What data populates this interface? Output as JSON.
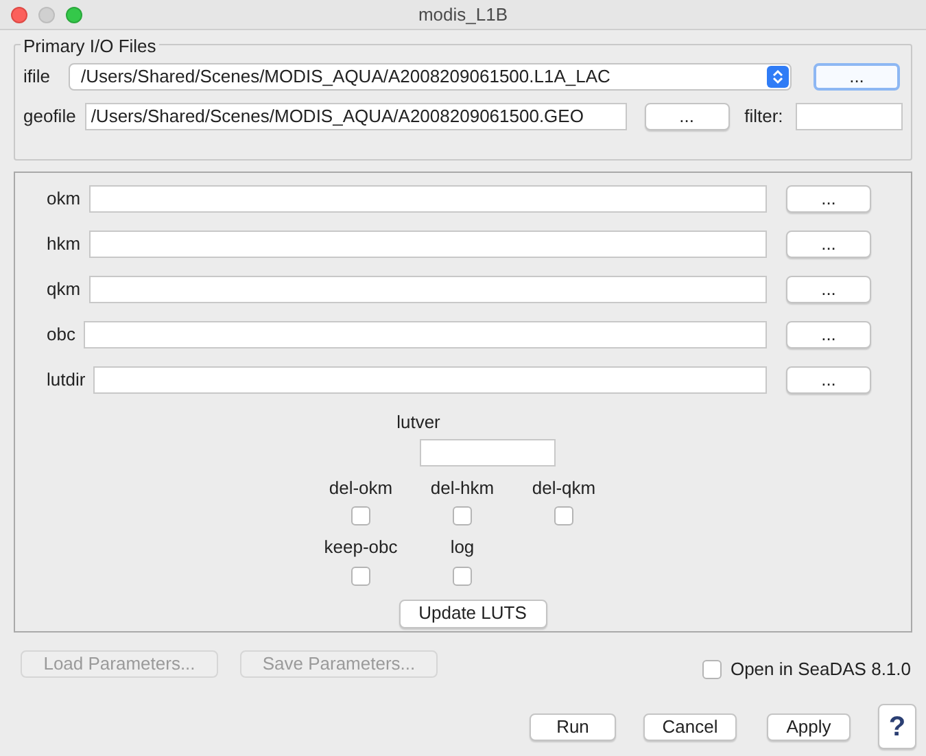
{
  "window": {
    "title": "modis_L1B"
  },
  "primary_io": {
    "title": "Primary I/O Files",
    "ifile": {
      "label": "ifile",
      "value": "/Users/Shared/Scenes/MODIS_AQUA/A2008209061500.L1A_LAC",
      "button": "...",
      "focused": true
    },
    "geofile": {
      "label": "geofile",
      "value": "/Users/Shared/Scenes/MODIS_AQUA/A2008209061500.GEO",
      "button": "..."
    },
    "filter": {
      "label": "filter:"
    }
  },
  "params": {
    "fields": [
      {
        "label": "okm",
        "button": "..."
      },
      {
        "label": "hkm",
        "button": "..."
      },
      {
        "label": "qkm",
        "button": "..."
      },
      {
        "label": "obc",
        "button": "..."
      },
      {
        "label": "lutdir",
        "button": "..."
      }
    ],
    "lutver": {
      "label": "lutver"
    },
    "checkbox_rows": [
      [
        {
          "label": "del-okm",
          "checked": false
        },
        {
          "label": "del-hkm",
          "checked": false
        },
        {
          "label": "del-qkm",
          "checked": false
        }
      ],
      [
        {
          "label": "keep-obc",
          "checked": false
        },
        {
          "label": "log",
          "checked": false
        }
      ]
    ],
    "update_button": "Update LUTS"
  },
  "load_button": {
    "label": "Load Parameters...",
    "disabled": true
  },
  "save_button": {
    "label": "Save Parameters...",
    "disabled": true
  },
  "open_in_seadas": {
    "label": "Open in SeaDAS 8.1.0",
    "checked": false
  },
  "buttons": [
    "Run",
    "Cancel",
    "Apply"
  ],
  "help_button": "?"
}
